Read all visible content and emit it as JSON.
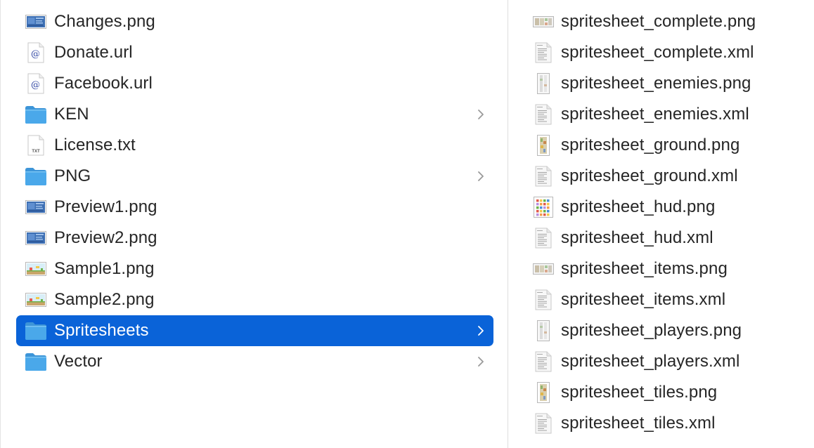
{
  "left_column": {
    "items": [
      {
        "name": "Changes.png",
        "type": "image",
        "thumb": "blue-screenshot",
        "has_children": false,
        "selected": false
      },
      {
        "name": "Donate.url",
        "type": "url",
        "has_children": false,
        "selected": false
      },
      {
        "name": "Facebook.url",
        "type": "url",
        "has_children": false,
        "selected": false
      },
      {
        "name": "KEN",
        "type": "folder",
        "has_children": true,
        "selected": false
      },
      {
        "name": "License.txt",
        "type": "text",
        "has_children": false,
        "selected": false
      },
      {
        "name": "PNG",
        "type": "folder",
        "has_children": true,
        "selected": false
      },
      {
        "name": "Preview1.png",
        "type": "image",
        "thumb": "blue-screenshot",
        "has_children": false,
        "selected": false
      },
      {
        "name": "Preview2.png",
        "type": "image",
        "thumb": "blue-screenshot",
        "has_children": false,
        "selected": false
      },
      {
        "name": "Sample1.png",
        "type": "image",
        "thumb": "game-scene",
        "has_children": false,
        "selected": false
      },
      {
        "name": "Sample2.png",
        "type": "image",
        "thumb": "game-scene",
        "has_children": false,
        "selected": false
      },
      {
        "name": "Spritesheets",
        "type": "folder",
        "has_children": true,
        "selected": true
      },
      {
        "name": "Vector",
        "type": "folder",
        "has_children": true,
        "selected": false
      }
    ]
  },
  "right_column": {
    "items": [
      {
        "name": "spritesheet_complete.png",
        "type": "image",
        "thumb": "wide-sheet"
      },
      {
        "name": "spritesheet_complete.xml",
        "type": "xml"
      },
      {
        "name": "spritesheet_enemies.png",
        "type": "image",
        "thumb": "tall-sheet"
      },
      {
        "name": "spritesheet_enemies.xml",
        "type": "xml"
      },
      {
        "name": "spritesheet_ground.png",
        "type": "image",
        "thumb": "tall-colorful"
      },
      {
        "name": "spritesheet_ground.xml",
        "type": "xml"
      },
      {
        "name": "spritesheet_hud.png",
        "type": "image",
        "thumb": "grid-sheet"
      },
      {
        "name": "spritesheet_hud.xml",
        "type": "xml"
      },
      {
        "name": "spritesheet_items.png",
        "type": "image",
        "thumb": "wide-sheet"
      },
      {
        "name": "spritesheet_items.xml",
        "type": "xml"
      },
      {
        "name": "spritesheet_players.png",
        "type": "image",
        "thumb": "tall-sheet"
      },
      {
        "name": "spritesheet_players.xml",
        "type": "xml"
      },
      {
        "name": "spritesheet_tiles.png",
        "type": "image",
        "thumb": "tall-colorful"
      },
      {
        "name": "spritesheet_tiles.xml",
        "type": "xml"
      }
    ]
  },
  "colors": {
    "selection": "#0a63d8",
    "folder": "#4aa8ea",
    "text": "#262626",
    "chevron": "#9a9a9a"
  }
}
